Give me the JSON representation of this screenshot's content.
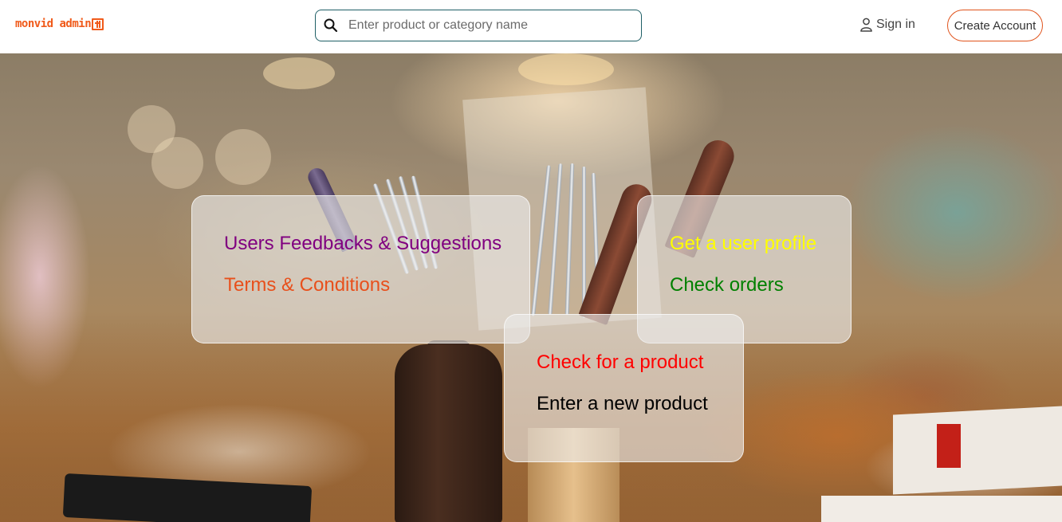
{
  "header": {
    "logo_text": "monvid admin",
    "logo_icon": "storefront-icon",
    "search_placeholder": "Enter product or category name",
    "signin_label": "Sign in",
    "create_account_label": "Create Account"
  },
  "cards": {
    "admin": {
      "feedback_label": "Users Feedbacks & Suggestions",
      "feedback_color": "#800080",
      "terms_label": "Terms & Conditions",
      "terms_color": "#e8501c"
    },
    "users": {
      "profile_label": "Get a user profile",
      "profile_color": "#ffff00",
      "orders_label": "Check orders",
      "orders_color": "#008000"
    },
    "products": {
      "check_label": "Check for a product",
      "check_color": "#ff0000",
      "new_label": "Enter a new product",
      "new_color": "#000000"
    }
  },
  "colors": {
    "accent": "#f05a1a",
    "search_border": "#1f5f66"
  }
}
